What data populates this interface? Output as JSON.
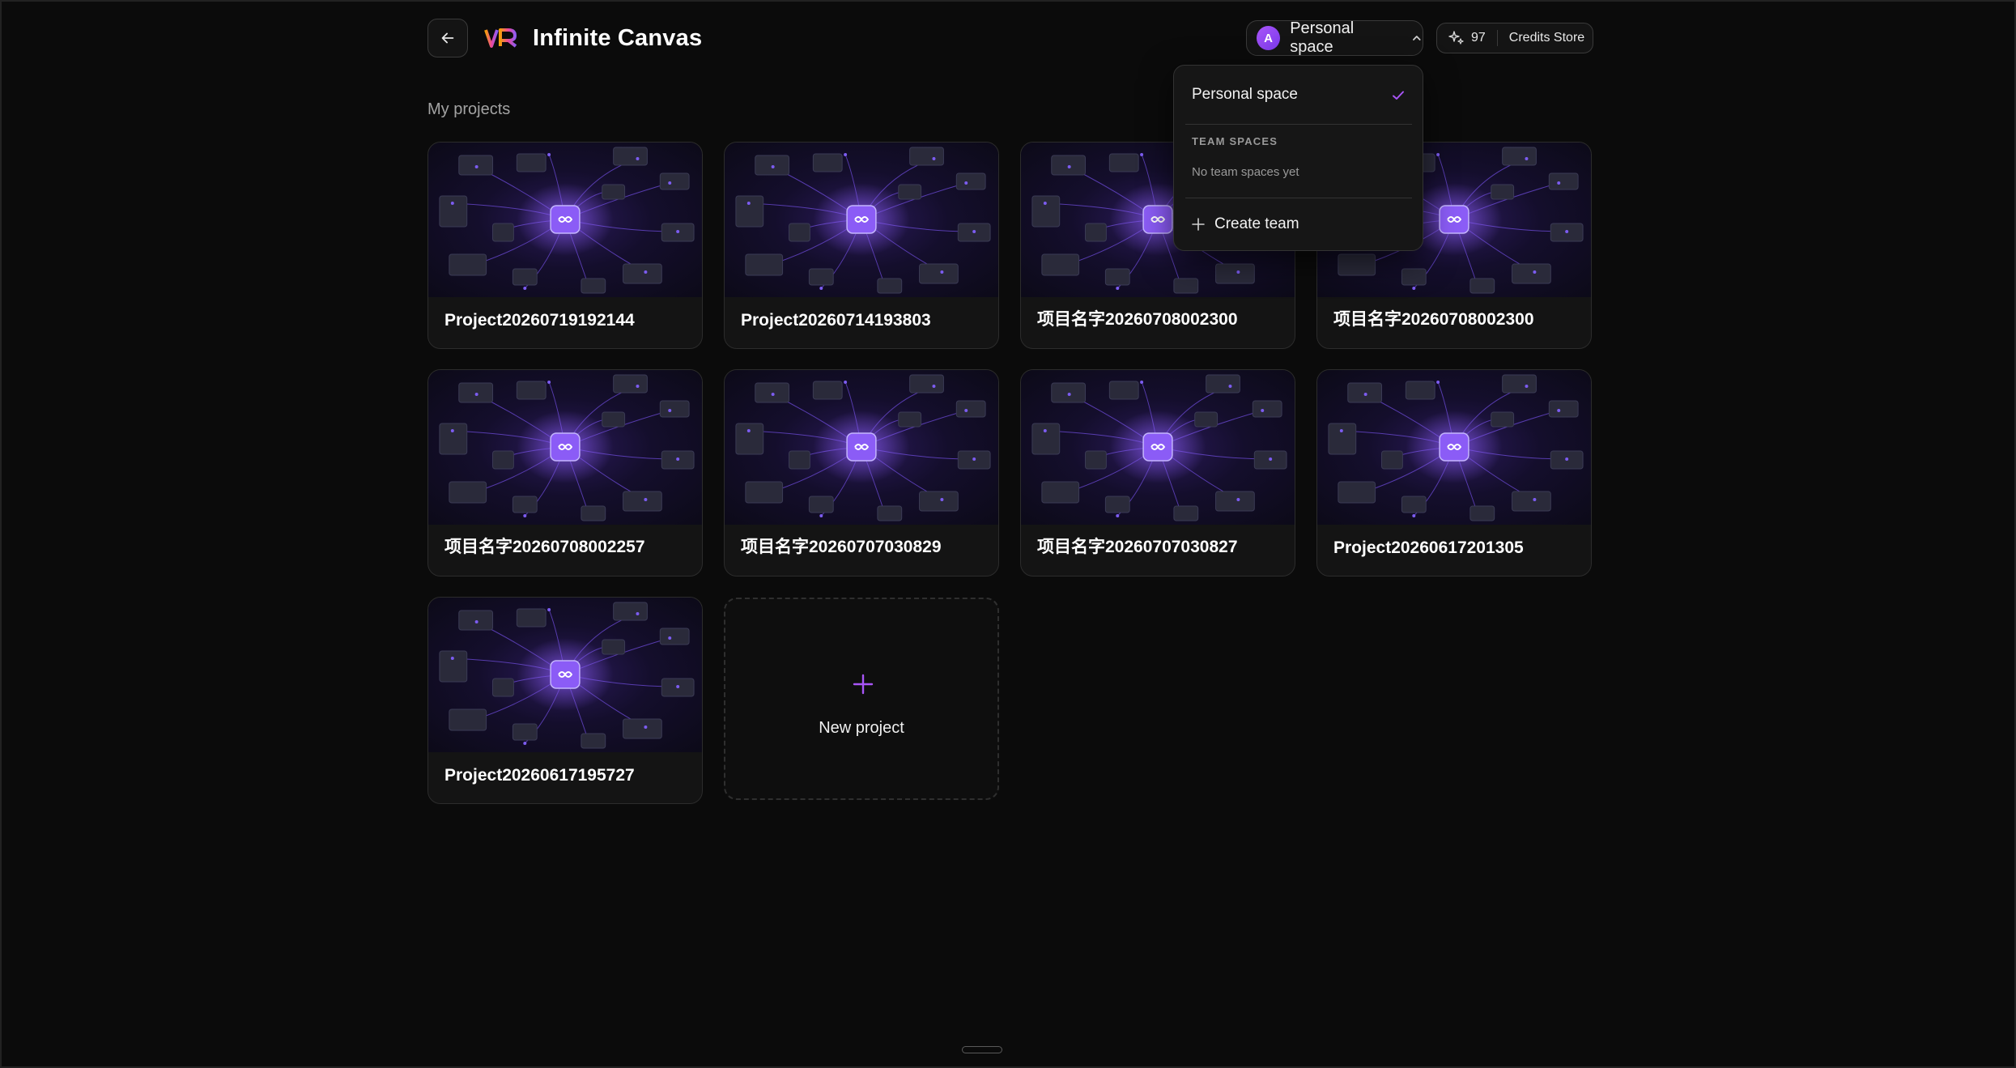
{
  "header": {
    "back_icon": "arrow-left-icon",
    "logo_icon": "vr-logo-icon",
    "title": "Infinite Canvas",
    "space_selector": {
      "avatar_letter": "A",
      "label": "Personal space",
      "icon": "chevron-up-icon"
    },
    "credits": {
      "icon": "sparkle-icon",
      "count": "97",
      "store_label": "Credits Store"
    }
  },
  "section_title": "My projects",
  "projects": [
    {
      "title": "Project20260719192144"
    },
    {
      "title": "Project20260714193803"
    },
    {
      "title": "项目名字20260708002300"
    },
    {
      "title": "项目名字20260708002300"
    },
    {
      "title": "项目名字20260708002257"
    },
    {
      "title": "项目名字20260707030829"
    },
    {
      "title": "项目名字20260707030827"
    },
    {
      "title": "Project20260617201305"
    },
    {
      "title": "Project20260617195727"
    }
  ],
  "new_project": {
    "icon": "plus-icon",
    "label": "New project"
  },
  "dropdown": {
    "personal_label": "Personal space",
    "personal_selected": true,
    "check_icon": "check-icon",
    "team_section_label": "TEAM SPACES",
    "team_empty_text": "No team spaces yet",
    "create_team_label": "Create team",
    "create_icon": "plus-icon"
  },
  "colors": {
    "accent": "#a855f7",
    "background": "#0b0b0b",
    "card": "#141414"
  }
}
